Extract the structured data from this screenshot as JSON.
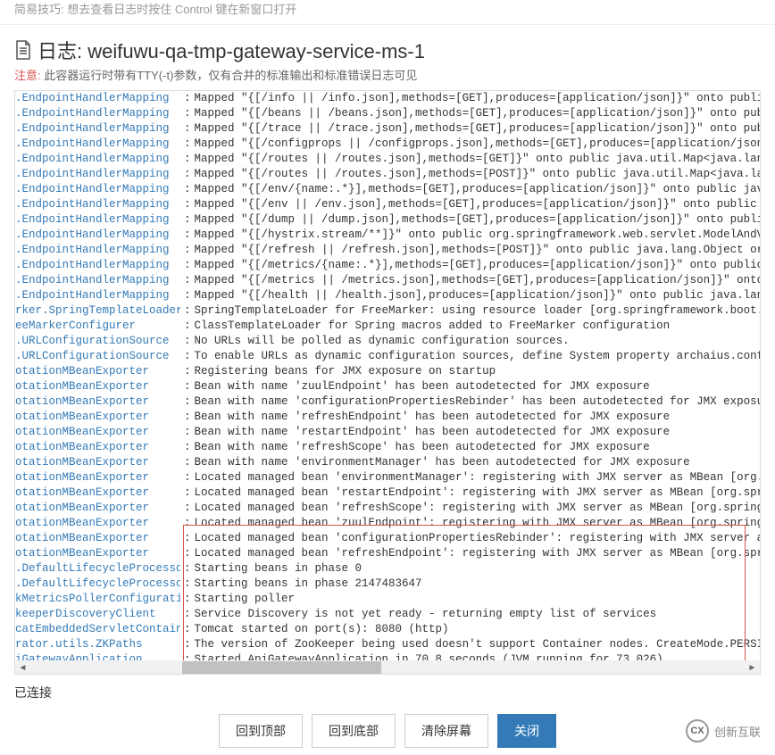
{
  "top_tip": "简易技巧: 想去查看日志时按住 Control 键在新窗口打开",
  "title": "日志: weifuwu-qa-tmp-gateway-service-ms-1",
  "note_label": "注意:",
  "note_text": "此容器运行时带有TTY(-t)参数，仅有合并的标准输出和标准错误日志可见",
  "status": "已连接",
  "buttons": {
    "top": "回到顶部",
    "bottom": "回到底部",
    "clear": "清除屏幕",
    "close": "关闭"
  },
  "brand": "创新互联",
  "logs": [
    {
      "cls": ".EndpointHandlerMapping",
      "msg": "Mapped \"{[/info || /info.json],methods=[GET],produces=[application/json]}\" onto public java.lang."
    },
    {
      "cls": ".EndpointHandlerMapping",
      "msg": "Mapped \"{[/beans || /beans.json],methods=[GET],produces=[application/json]}\" onto public java.lan"
    },
    {
      "cls": ".EndpointHandlerMapping",
      "msg": "Mapped \"{[/trace || /trace.json],methods=[GET],produces=[application/json]}\" onto public java.lan"
    },
    {
      "cls": ".EndpointHandlerMapping",
      "msg": "Mapped \"{[/configprops || /configprops.json],methods=[GET],produces=[application/json]}\" onto pub"
    },
    {
      "cls": ".EndpointHandlerMapping",
      "msg": "Mapped \"{[/routes || /routes.json],methods=[GET]}\" onto public java.util.Map<java.lang.String, ja"
    },
    {
      "cls": ".EndpointHandlerMapping",
      "msg": "Mapped \"{[/routes || /routes.json],methods=[POST]}\" onto public java.util.Map<java.lang.String, j"
    },
    {
      "cls": ".EndpointHandlerMapping",
      "msg": "Mapped \"{[/env/{name:.*}],methods=[GET],produces=[application/json]}\" onto public java.lang.Objec"
    },
    {
      "cls": ".EndpointHandlerMapping",
      "msg": "Mapped \"{[/env || /env.json],methods=[GET],produces=[application/json]}\" onto public java.lang.Ob"
    },
    {
      "cls": ".EndpointHandlerMapping",
      "msg": "Mapped \"{[/dump || /dump.json],methods=[GET],produces=[application/json]}\" onto public java.lang."
    },
    {
      "cls": ".EndpointHandlerMapping",
      "msg": "Mapped \"{[/hystrix.stream/**]}\" onto public org.springframework.web.servlet.ModelAndView org.spri"
    },
    {
      "cls": ".EndpointHandlerMapping",
      "msg": "Mapped \"{[/refresh || /refresh.json],methods=[POST]}\" onto public java.lang.Object org.springfram"
    },
    {
      "cls": ".EndpointHandlerMapping",
      "msg": "Mapped \"{[/metrics/{name:.*}],methods=[GET],produces=[application/json]}\" onto public java.lang.O"
    },
    {
      "cls": ".EndpointHandlerMapping",
      "msg": "Mapped \"{[/metrics || /metrics.json],methods=[GET],produces=[application/json]}\" onto public java"
    },
    {
      "cls": ".EndpointHandlerMapping",
      "msg": "Mapped \"{[/health || /health.json],produces=[application/json]}\" onto public java.lang.Object org"
    },
    {
      "cls": "rker.SpringTemplateLoader",
      "msg": "SpringTemplateLoader for FreeMarker: using resource loader [org.springframework.boot.context.embe"
    },
    {
      "cls": "eeMarkerConfigurer",
      "msg": "ClassTemplateLoader for Spring macros added to FreeMarker configuration"
    },
    {
      "cls": ".URLConfigurationSource",
      "msg": "No URLs will be polled as dynamic configuration sources."
    },
    {
      "cls": ".URLConfigurationSource",
      "msg": "To enable URLs as dynamic configuration sources, define System property archaius.configurationSou"
    },
    {
      "cls": "otationMBeanExporter",
      "msg": "Registering beans for JMX exposure on startup"
    },
    {
      "cls": "otationMBeanExporter",
      "msg": "Bean with name 'zuulEndpoint' has been autodetected for JMX exposure"
    },
    {
      "cls": "otationMBeanExporter",
      "msg": "Bean with name 'configurationPropertiesRebinder' has been autodetected for JMX exposure"
    },
    {
      "cls": "otationMBeanExporter",
      "msg": "Bean with name 'refreshEndpoint' has been autodetected for JMX exposure"
    },
    {
      "cls": "otationMBeanExporter",
      "msg": "Bean with name 'restartEndpoint' has been autodetected for JMX exposure"
    },
    {
      "cls": "otationMBeanExporter",
      "msg": "Bean with name 'refreshScope' has been autodetected for JMX exposure"
    },
    {
      "cls": "otationMBeanExporter",
      "msg": "Bean with name 'environmentManager' has been autodetected for JMX exposure"
    },
    {
      "cls": "otationMBeanExporter",
      "msg": "Located managed bean 'environmentManager': registering with JMX server as MBean [org.springframew"
    },
    {
      "cls": "otationMBeanExporter",
      "msg": "Located managed bean 'restartEndpoint': registering with JMX server as MBean [org.springframework.cl"
    },
    {
      "cls": "otationMBeanExporter",
      "msg": "Located managed bean 'refreshScope': registering with JMX server as MBean [org.springframework.cl"
    },
    {
      "cls": "otationMBeanExporter",
      "msg": "Located managed bean 'zuulEndpoint': registering with JMX server as MBean [org.springframework.cl"
    },
    {
      "cls": "otationMBeanExporter",
      "msg": "Located managed bean 'configurationPropertiesRebinder': registering with JMX server as MBean [org"
    },
    {
      "cls": "otationMBeanExporter",
      "msg": "Located managed bean 'refreshEndpoint': registering with JMX server as MBean [org.springframework"
    },
    {
      "cls": ".DefaultLifecycleProcessor",
      "msg": "Starting beans in phase 0"
    },
    {
      "cls": ".DefaultLifecycleProcessor",
      "msg": "Starting beans in phase 2147483647"
    },
    {
      "cls": "kMetricsPollerConfiguration",
      "msg": "Starting poller"
    },
    {
      "cls": "keeperDiscoveryClient",
      "msg": "Service Discovery is not yet ready - returning empty list of services"
    },
    {
      "cls": "catEmbeddedServletContainer",
      "msg": "Tomcat started on port(s): 8080 (http)"
    },
    {
      "cls": "rator.utils.ZKPaths",
      "msg": "The version of ZooKeeper being used doesn't support Container nodes. CreateMode.PERSISTENT will b"
    },
    {
      "cls": "iGatewayApplication",
      "msg": "Started ApiGatewayApplication in 70.8 seconds (JVM running for 73.026)"
    }
  ]
}
